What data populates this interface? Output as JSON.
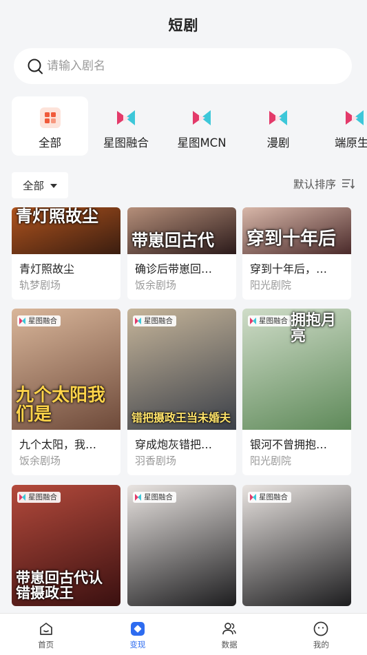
{
  "header": {
    "title": "短剧"
  },
  "search": {
    "placeholder": "请输入剧名",
    "icon": "search-icon"
  },
  "categories": [
    {
      "label": "全部",
      "icon": "grid-icon",
      "active": true
    },
    {
      "label": "星图融合",
      "icon": "xingtu-logo-icon"
    },
    {
      "label": "星图MCN",
      "icon": "xingtu-logo-icon"
    },
    {
      "label": "漫剧",
      "icon": "xingtu-logo-icon"
    },
    {
      "label": "端原生",
      "icon": "xingtu-logo-icon"
    }
  ],
  "filter": {
    "label": "全部"
  },
  "sort": {
    "label": "默认排序",
    "icon": "sort-icon"
  },
  "cards": [
    {
      "name": "青灯照故尘",
      "studio": "轨梦剧场",
      "cover_text": "青灯照故尘",
      "colors": [
        "#3a1d10",
        "#b0541e"
      ]
    },
    {
      "name": "确诊后带崽回…",
      "studio": "饭余剧场",
      "cover_text": "带崽回古代",
      "colors": [
        "#2b1a1a",
        "#b58f7a"
      ]
    },
    {
      "name": "穿到十年后，…",
      "studio": "阳光剧院",
      "cover_text": "穿到十年后",
      "colors": [
        "#4a2a2a",
        "#d8b7a9"
      ]
    },
    {
      "name": "九个太阳，我…",
      "studio": "饭余剧场",
      "badge": "星图融合",
      "cover_text": "九个太阳我们是",
      "colors": [
        "#6e4a3a",
        "#d9b69a"
      ]
    },
    {
      "name": "穿成炮灰错把…",
      "studio": "羽香剧场",
      "badge": "星图融合",
      "cover_text": "错把摄政王当未婚夫",
      "colors": [
        "#3a3f48",
        "#c6b59a"
      ]
    },
    {
      "name": "银河不曾拥抱…",
      "studio": "阳光剧院",
      "badge": "星图融合",
      "cover_text": "拥抱月亮",
      "colors": [
        "#5f8a5a",
        "#cfdcc8"
      ]
    },
    {
      "name": "",
      "studio": "",
      "badge": "星图融合",
      "cover_text": "带崽回古代认错摄政王",
      "colors": [
        "#3a1010",
        "#b44a3c"
      ]
    },
    {
      "name": "",
      "studio": "",
      "badge": "星图融合",
      "cover_text": "",
      "colors": [
        "#1d1d1f",
        "#e9e4e1"
      ]
    },
    {
      "name": "",
      "studio": "",
      "badge": "星图融合",
      "cover_text": "",
      "colors": [
        "#1d1d1f",
        "#e9e4e1"
      ]
    }
  ],
  "tabs": [
    {
      "label": "首页",
      "icon": "home-icon"
    },
    {
      "label": "变现",
      "icon": "monetize-icon",
      "active": true
    },
    {
      "label": "数据",
      "icon": "users-icon"
    },
    {
      "label": "我的",
      "icon": "profile-icon"
    }
  ],
  "colors": {
    "accent": "#2e6cf0",
    "grid_icon": "#f05a3a",
    "xingtu_pink": "#e33a6a",
    "xingtu_cyan": "#3dc7d9"
  }
}
